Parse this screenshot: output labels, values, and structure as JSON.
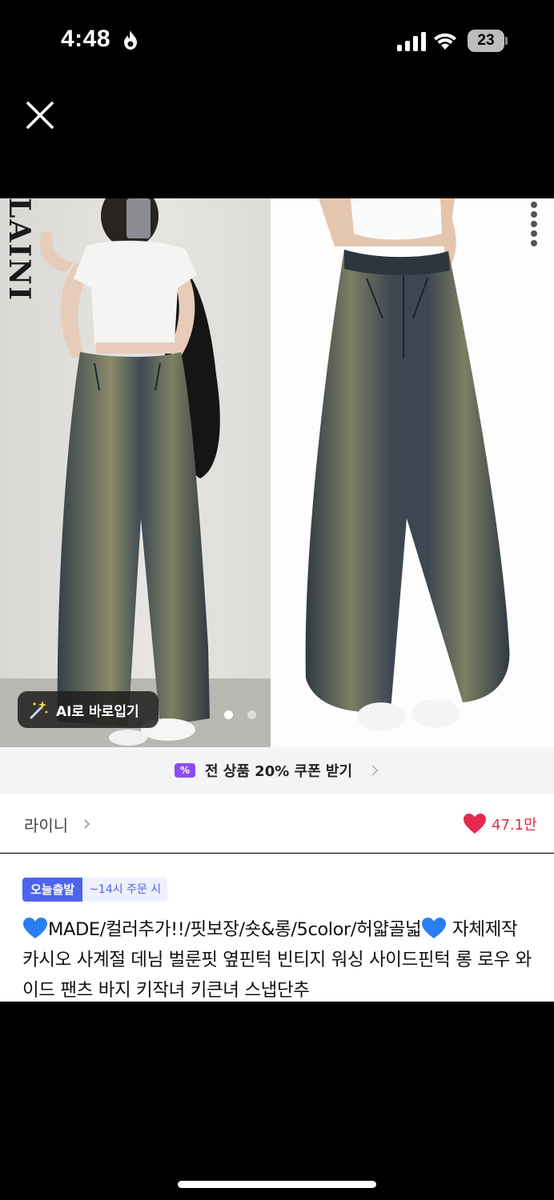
{
  "status_bar": {
    "time": "4:48",
    "battery": "23"
  },
  "gallery": {
    "brand_watermark": "LAINI",
    "ai_button_label": "AI로 바로입기",
    "page_count": 2,
    "active_page": 1
  },
  "coupon": {
    "icon": "%",
    "label": "전 상품 20% 쿠폰 받기"
  },
  "seller": {
    "name": "라이니",
    "likes": "47.1만"
  },
  "product": {
    "badge_today": "오늘출발",
    "badge_time": "~14시 주문 시",
    "title_part1": "MADE/컬러추가!!/핏보장/숏&롱/5color/허얇골넓",
    "title_part2": " 자체제작 카시오 사계절 데님 벌룬핏 옆핀턱 빈티지 워싱 사이드핀턱 롱 로우 와이드 팬츠 바지 키작녀 키큰녀 스냅단추"
  },
  "colors": {
    "accent_purple": "#8b4cf0",
    "accent_blue": "#4e63ee",
    "like_red": "#e6284e"
  }
}
